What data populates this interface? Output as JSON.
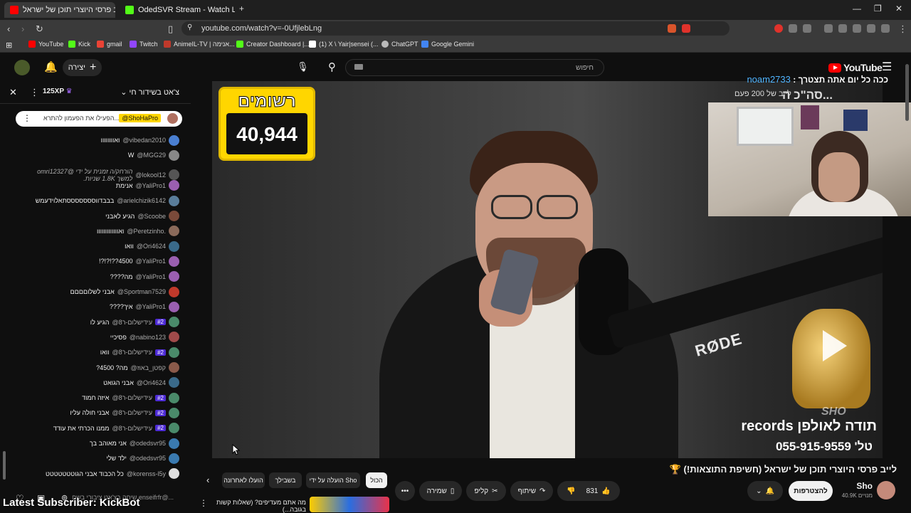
{
  "browser": {
    "tabs": [
      {
        "title": "לייב פרסי היוצרי תוכן של ישראל",
        "active": true,
        "color": "#ff0000"
      },
      {
        "title": "OdedSVR Stream - Watch Live on Ki...",
        "active": false,
        "color": "#53fc18"
      }
    ],
    "url": "youtube.com/watch?v=-0UfjlebLng",
    "bookmarks": [
      {
        "label": "YouTube",
        "color": "#ff0000"
      },
      {
        "label": "Kick",
        "color": "#53fc18"
      },
      {
        "label": "gmail",
        "color": "#ea4335"
      },
      {
        "label": "Twitch",
        "color": "#9146ff"
      },
      {
        "label": "AnimeIL-TV | אנימה...",
        "color": "#c0392b"
      },
      {
        "label": "Creator Dashboard |...",
        "color": "#53fc18"
      },
      {
        "label": "(1) X \\ Yair|sensei (...",
        "color": "#ffffff"
      },
      {
        "label": "ChatGPT",
        "color": "#bbbbbb"
      },
      {
        "label": "Google Gemini",
        "color": "#4285f4"
      }
    ]
  },
  "yt": {
    "create_label": "יצירה",
    "search_placeholder": "חיפוש",
    "logo_text": "YouTube"
  },
  "chat": {
    "mode_label": "צ'אט בשידור חי",
    "xp_label": "125XP",
    "pinned": {
      "author": "@ShoHaPro",
      "text": "הפעילו את הפעמון להתרא..."
    },
    "messages": [
      {
        "author": "@vibedan2010",
        "text": "ואוווווווו",
        "color": "#4a7fd1"
      },
      {
        "author": "@MGG29",
        "text": "W",
        "color": "#888888"
      },
      {
        "author": "@lokool12",
        "text": "הורחק/ה זמנית על ידי @omri12327 למשך 1.8K שניות.",
        "color": "#555555"
      },
      {
        "author": "@YaliPro1",
        "text": "אנימת",
        "color": "#9a5fb0"
      },
      {
        "author": "@arielchizik6142",
        "text": "בבבדווסססססססתאלוידעמש",
        "color": "#5a7d9a"
      },
      {
        "author": "@Scoobe",
        "text": "הגיע לאבני",
        "color": "#7a4a3a"
      },
      {
        "author": "@Peretzinho.",
        "text": "ואווווווווווווו",
        "color": "#8a6a5a"
      },
      {
        "author": "@Ori4624",
        "text": "וואו",
        "color": "#3a6a8a"
      },
      {
        "author": "@YaliPro1",
        "text": "4500??!?!?!",
        "color": "#9a5fb0"
      },
      {
        "author": "@YaliPro1",
        "text": "מה????",
        "color": "#9a5fb0"
      },
      {
        "author": "@Sportman7529",
        "text": "אבני לשלוםםםם",
        "color": "#c0392b"
      },
      {
        "author": "@YaliPro1",
        "text": "איך????",
        "color": "#9a5fb0"
      },
      {
        "author": "@עידישלום-ר8",
        "badge": "#2",
        "text": "הגיע לו",
        "color": "#4a8a6a"
      },
      {
        "author": "@nabino123",
        "text": "פסיכיי",
        "color": "#a04a4a"
      },
      {
        "author": "@עידישלום-ר8",
        "badge": "#2",
        "text": "וואו",
        "color": "#4a8a6a"
      },
      {
        "author": "@קפטן_באוז",
        "text": "מה? 4500?",
        "color": "#8a5a4a"
      },
      {
        "author": "@Ori4624",
        "text": "אבני הגואט",
        "color": "#3a6a8a"
      },
      {
        "author": "@עידישלום-ר8",
        "badge": "#2",
        "text": "איזה חמוד",
        "color": "#4a8a6a"
      },
      {
        "author": "@עידישלום-ר8",
        "badge": "#2",
        "text": "אבני חולה עליו",
        "color": "#4a8a6a"
      },
      {
        "author": "@עידישלום-ר8",
        "badge": "#2",
        "text": "ממנו הכרתי את עודד",
        "color": "#4a8a6a"
      },
      {
        "author": "@odedsvr95",
        "text": "אני מאוהב בך",
        "color": "#3a7ab0"
      },
      {
        "author": "@odedsvr95",
        "text": "ילד שלי",
        "color": "#3a7ab0"
      },
      {
        "author": "@korenss-l5y",
        "text": "כל הכבוד אבני הגוטטטטטטט",
        "color": "#dddddd"
      }
    ],
    "input_placeholder": "שיחה בצ'אט ציבורי בשם enseifrfr@..."
  },
  "video": {
    "subs_label": "רשומים",
    "subs_count": "40,944",
    "rode_text": "RØDE",
    "watermark": "SHO",
    "thanks_text": "תודה לאולפן records",
    "phone_text": "טל' 055-915-9559",
    "overlay_user": "noam2733",
    "overlay_msg": "ככה כל יום אתה תצטרך :",
    "overlay_title": "סה\"כ ה...",
    "overlay_sub": "לייב של 200 פעם"
  },
  "below": {
    "title": "לייב פרסי היוצרי תוכן של ישראל (חשיפת התוצאות!) 🏆",
    "channel": "Sho",
    "channel_subs": "40.9K מנויים",
    "subscribe_label": "להצטרפות",
    "like_count": "831",
    "share_label": "שיתוף",
    "clip_label": "קליפ",
    "save_label": "שמירה",
    "chips": [
      "הכול",
      "הועלה על ידי Sho",
      "בשבילך",
      "הועלו לאחרונה"
    ],
    "rec_title": "מה אתם מעדיפים? (שאלות קשות בגובה...)",
    "latest_sub": "Latest Subscriber: KickBot"
  }
}
